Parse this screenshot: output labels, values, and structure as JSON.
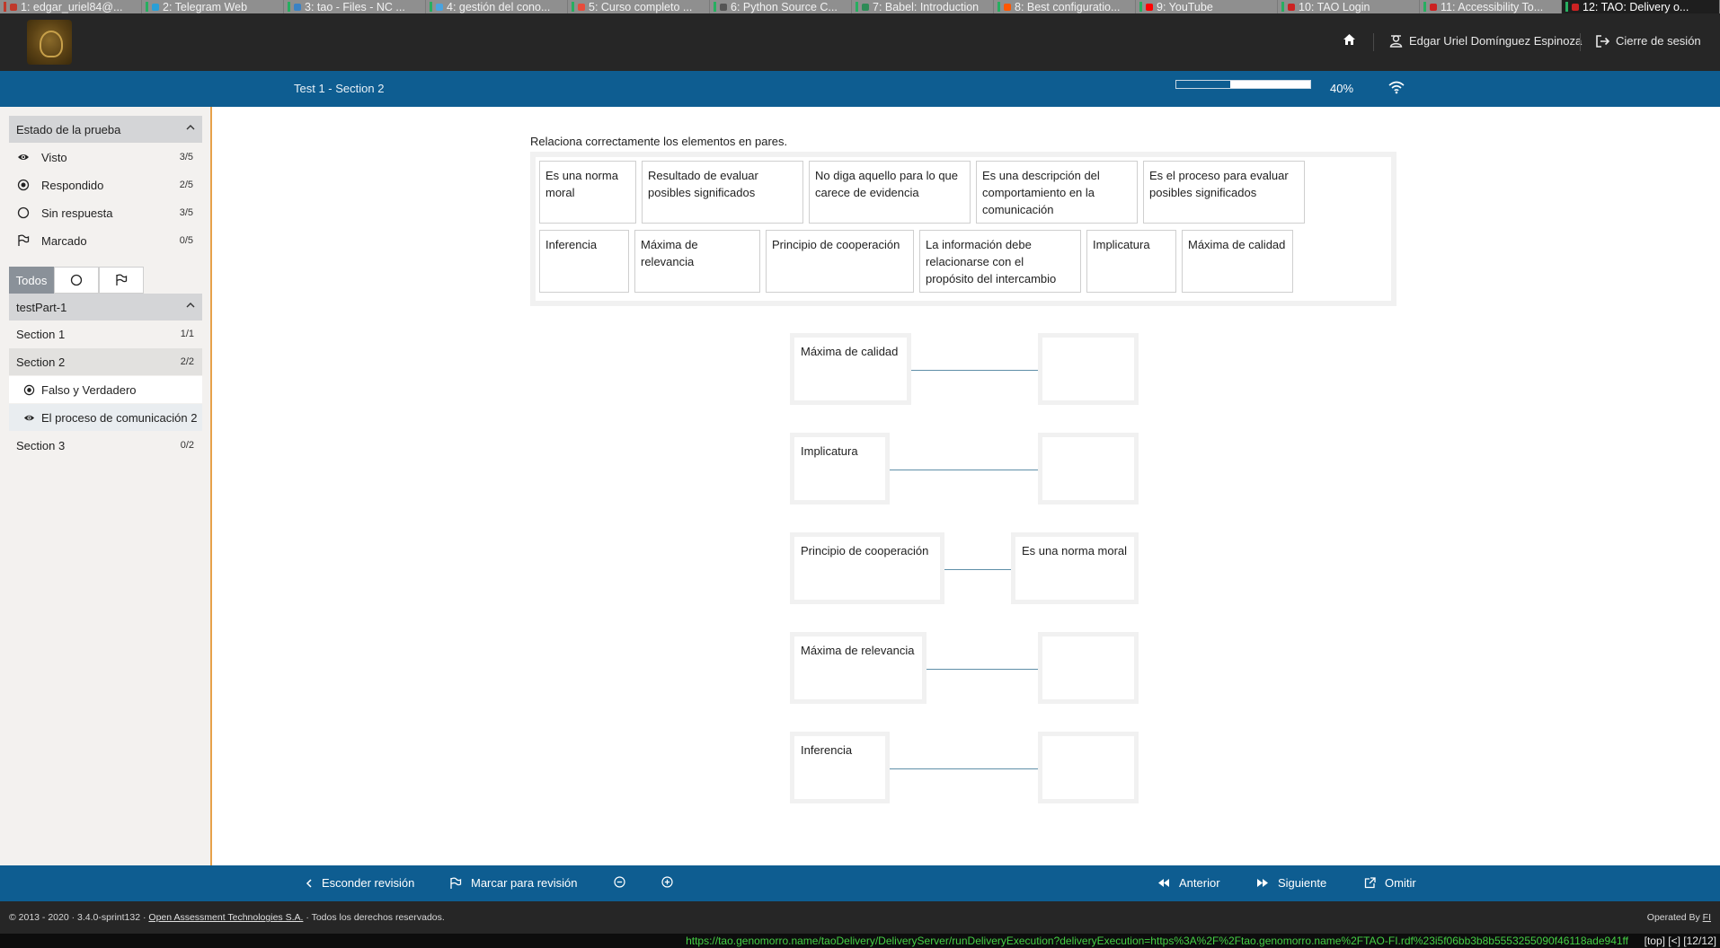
{
  "browser": {
    "tabs": [
      {
        "label": "1: edgar_uriel84@...",
        "mark": "#c0392b",
        "icon": "#c0392b",
        "active": false
      },
      {
        "label": "2: Telegram Web",
        "mark": "#27ae60",
        "icon": "#2a9fd6",
        "active": false
      },
      {
        "label": "3: tao - Files - NC ...",
        "mark": "#27ae60",
        "icon": "#3b82c4",
        "active": false
      },
      {
        "label": "4: gestión del cono...",
        "mark": "#27ae60",
        "icon": "#4aa3df",
        "active": false
      },
      {
        "label": "5: Curso completo ...",
        "mark": "#27ae60",
        "icon": "#e74c3c",
        "active": false
      },
      {
        "label": "6: Python Source C...",
        "mark": "#27ae60",
        "icon": "#555555",
        "active": false
      },
      {
        "label": "7: Babel: Introduction",
        "mark": "#27ae60",
        "icon": "#2e8b57",
        "active": false
      },
      {
        "label": "8: Best configuratio...",
        "mark": "#27ae60",
        "icon": "#ff5700",
        "active": false
      },
      {
        "label": "9: YouTube",
        "mark": "#27ae60",
        "icon": "#ff0000",
        "active": false
      },
      {
        "label": "10: TAO Login",
        "mark": "#27ae60",
        "icon": "#cc2222",
        "active": false
      },
      {
        "label": "11: Accessibility To...",
        "mark": "#27ae60",
        "icon": "#cc2222",
        "active": false
      },
      {
        "label": "12: TAO: Delivery o...",
        "mark": "#27ae60",
        "icon": "#cc2222",
        "active": true
      }
    ],
    "status_url": "https://tao.genomorro.name/taoDelivery/DeliveryServer/runDeliveryExecution?deliveryExecution=https%3A%2F%2Ftao.genomorro.name%2FTAO-FI.rdf%23i5f06bb3b8b5553255090f46118ade941ff",
    "status_extra": "[top] [<] [12/12]"
  },
  "header": {
    "home_icon": "home-icon",
    "user_name": "Edgar Uriel Domínguez Espinoza",
    "logout_label": "Cierre de sesión"
  },
  "titlebar": {
    "title": "Test 1 - Section 2",
    "progress": 0.4,
    "progress_label": "40%"
  },
  "sidebar": {
    "status_title": "Estado de la prueba",
    "stats": [
      {
        "icon": "eye-icon",
        "label": "Visto",
        "count": "3/5"
      },
      {
        "icon": "radio-checked-icon",
        "label": "Respondido",
        "count": "2/5"
      },
      {
        "icon": "circle-icon",
        "label": "Sin respuesta",
        "count": "3/5"
      },
      {
        "icon": "flag-icon",
        "label": "Marcado",
        "count": "0/5"
      }
    ],
    "filters": {
      "all": "Todos"
    },
    "part_title": "testPart-1",
    "sections": [
      {
        "label": "Section 1",
        "count": "1/1"
      },
      {
        "label": "Section 2",
        "count": "2/2"
      },
      {
        "label": "Section 3",
        "count": "0/2"
      }
    ],
    "items": [
      {
        "label": "Falso y Verdadero",
        "icon": "radio-checked-icon"
      },
      {
        "label": "El proceso de comunicación 2",
        "icon": "eye-icon"
      }
    ]
  },
  "question": {
    "prompt": "Relaciona correctamente los elementos en pares.",
    "choices_row1": [
      "Es una norma moral",
      "Resultado de evaluar posibles significados",
      "No diga aquello para lo que carece de evidencia",
      "Es una descripción del comportamiento en la comunicación",
      "Es el proceso para evaluar posibles significados"
    ],
    "choices_row2": [
      "Inferencia",
      "Máxima de relevancia",
      "Principio de cooperación",
      "La información debe relacionarse con el propósito del intercambio",
      "Implicatura",
      "Máxima de calidad"
    ],
    "pairs": [
      {
        "left": "Máxima de calidad",
        "right": ""
      },
      {
        "left": "Implicatura",
        "right": ""
      },
      {
        "left": "Principio de cooperación",
        "right": "Es una norma moral"
      },
      {
        "left": "Máxima de relevancia",
        "right": ""
      },
      {
        "left": "Inferencia",
        "right": ""
      }
    ]
  },
  "bottom_nav": {
    "hide_review": "Esconder revisión",
    "mark_review": "Marcar para revisión",
    "previous": "Anterior",
    "next": "Siguiente",
    "skip": "Omitir"
  },
  "footer": {
    "copyright_prefix": "© 2013 - 2020 · 3.4.0-sprint132 · ",
    "company": "Open Assessment Technologies S.A.",
    "rights": " · Todos los derechos reservados.",
    "operated_by": "Operated By",
    "operator": "FI"
  },
  "colors": {
    "brand_blue": "#0e5d91",
    "header_dark": "#262626",
    "accent_orange": "#e7a14a"
  }
}
